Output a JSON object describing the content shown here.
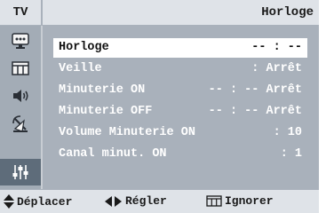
{
  "header": {
    "source": "TV",
    "title": "Horloge"
  },
  "sidebar": {
    "items": [
      {
        "icon": "picture-icon"
      },
      {
        "icon": "sound-bars-icon"
      },
      {
        "icon": "speaker-icon"
      },
      {
        "icon": "satellite-antenna-icon"
      },
      {
        "icon": "setup-sliders-icon",
        "selected": true
      }
    ]
  },
  "menu": {
    "rows": [
      {
        "label": "Horloge",
        "value": "-- : --"
      },
      {
        "label": "Veille",
        "value": ": Arrêt"
      },
      {
        "label": "Minuterie ON",
        "value": "-- : -- Arrêt"
      },
      {
        "label": "Minuterie OFF",
        "value": "-- : -- Arrêt"
      },
      {
        "label": "Volume Minuterie ON",
        "value": ": 10"
      },
      {
        "label": "Canal minut. ON",
        "value": ": 1"
      }
    ],
    "selected_index": 0
  },
  "footer": {
    "move": "Déplacer",
    "adjust": "Régler",
    "exit": "Ignorer"
  },
  "colors": {
    "panel": "#a9b1bb",
    "header": "#dfe3e8",
    "selected_icon": "#5e6c7a",
    "selected_row": "#ffffff",
    "text": "#ffffff"
  }
}
